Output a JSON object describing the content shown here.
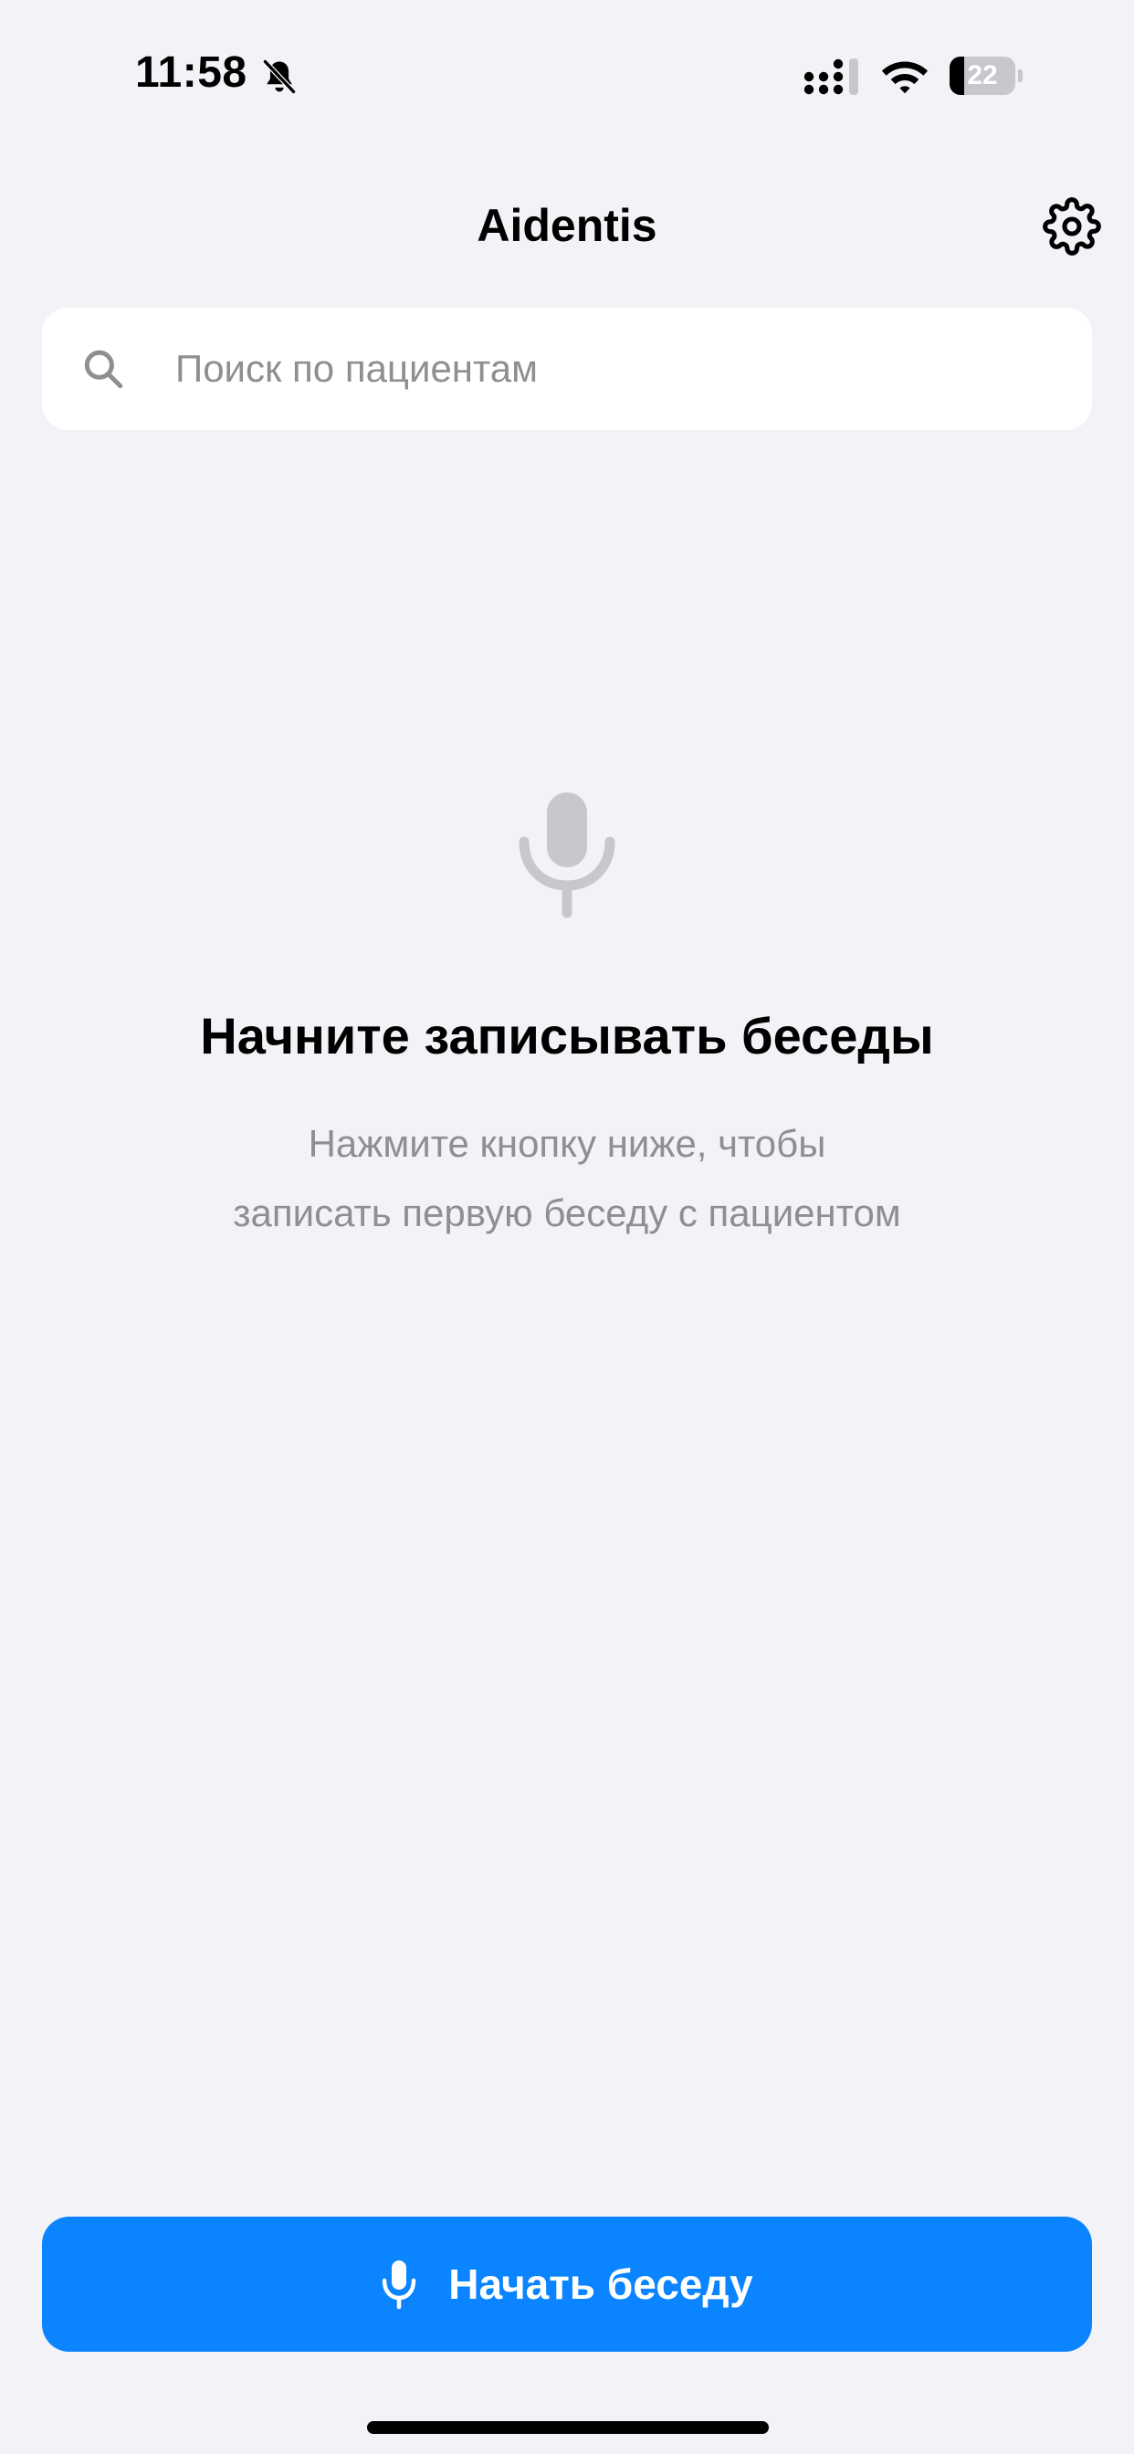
{
  "status_bar": {
    "time": "11:58",
    "battery_level": "22",
    "battery_fraction": 0.22
  },
  "nav": {
    "title": "Aidentis",
    "settings_icon": "gear-icon"
  },
  "search": {
    "placeholder": "Поиск по пациентам",
    "value": "",
    "icon": "search-icon"
  },
  "empty_state": {
    "icon": "microphone-icon",
    "title": "Начните записывать беседы",
    "subtitle_line1": "Нажмите кнопку ниже, чтобы",
    "subtitle_line2": "записать первую беседу с пациентом"
  },
  "start_button": {
    "label": "Начать беседу",
    "icon": "microphone-icon"
  },
  "colors": {
    "background": "#f2f2f7",
    "accent": "#0a84ff",
    "secondary_text": "#8e8e93",
    "empty_icon": "#c7c7cc"
  }
}
